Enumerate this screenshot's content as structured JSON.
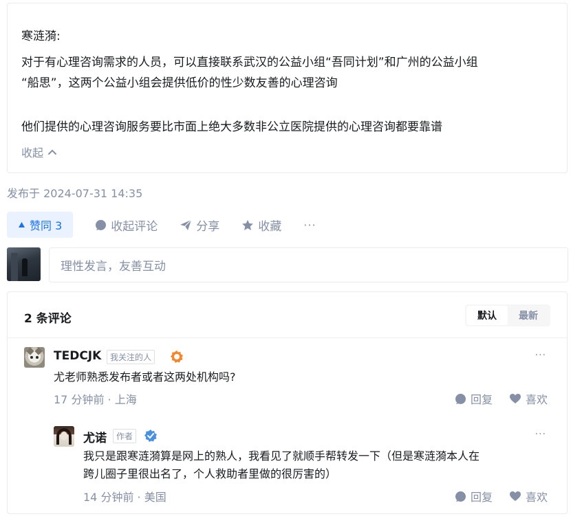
{
  "quote": {
    "author": "寒涟漪:",
    "paragraph1_line1": "对于有心理咨询需求的人员，可以直接联系武汉的公益小组“吾同计划”和广州的公益小组",
    "paragraph1_line2": "“船思”，这两个公益小组会提供低价的性少数友善的心理咨询",
    "paragraph2": "他们提供的心理咨询服务要比市面上绝大多数非公立医院提供的心理咨询都要靠谱",
    "collapse_label": "收起"
  },
  "publish_time": "发布于 2024-07-31 14:35",
  "actions": {
    "vote_label": "赞同 3",
    "comment_label": "收起评论",
    "share_label": "分享",
    "favorite_label": "收藏",
    "more_label": "···"
  },
  "comment_input": {
    "placeholder": "理性发言，友善互动"
  },
  "comments": {
    "title": "2 条评论",
    "sort_options": [
      "默认",
      "最新"
    ],
    "sort_selected": "默认",
    "items": [
      {
        "name": "TEDCJK",
        "badge": "我关注的人",
        "text": "尤老师熟悉发布者或者这两处机构吗?",
        "time": "17 分钟前",
        "location": "上海",
        "reply_label": "回复",
        "like_label": "喜欢",
        "more_label": "···"
      },
      {
        "name": "尤诺",
        "badge": "作者",
        "text_line1": "我只是跟寒涟漪算是网上的熟人，我看见了就顺手帮转发一下（但是寒涟漪本人在",
        "text_line2": "跨儿圈子里很出名了，个人救助者里做的很厉害的）",
        "time": "14 分钟前",
        "location": "美国",
        "reply_label": "回复",
        "like_label": "喜欢",
        "more_label": "···"
      }
    ]
  },
  "colors": {
    "accent": "#1772f6",
    "accent_bg": "#eaf1ff",
    "muted": "#8590a6",
    "text": "#191b1f",
    "verified_badge": "#4a90e2",
    "follow_badge": "#f5862e"
  },
  "icons": [
    "triangle-up-icon",
    "comment-bubble-icon",
    "paper-plane-icon",
    "star-icon",
    "chevron-up-icon",
    "follow-badge-icon",
    "verified-badge-icon",
    "heart-icon"
  ]
}
